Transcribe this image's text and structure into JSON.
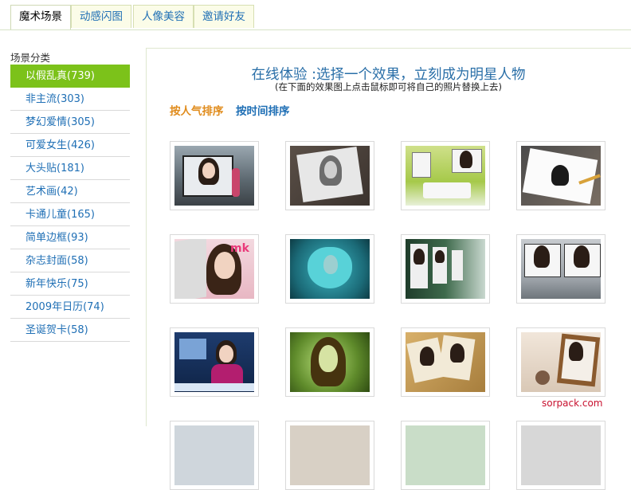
{
  "tabs": [
    {
      "label": "魔术场景",
      "active": true
    },
    {
      "label": "动感闪图",
      "active": false
    },
    {
      "label": "人像美容",
      "active": false
    },
    {
      "label": "邀请好友",
      "active": false
    }
  ],
  "sidebar": {
    "title": "场景分类",
    "items": [
      {
        "label": "以假乱真(739)",
        "active": true
      },
      {
        "label": "非主流(303)"
      },
      {
        "label": "梦幻爱情(305)"
      },
      {
        "label": "可爱女生(426)"
      },
      {
        "label": "大头贴(181)"
      },
      {
        "label": "艺术画(42)"
      },
      {
        "label": "卡通儿童(165)"
      },
      {
        "label": "简单边框(93)"
      },
      {
        "label": "杂志封面(58)"
      },
      {
        "label": "新年快乐(75)"
      },
      {
        "label": "2009年日历(74)"
      },
      {
        "label": "圣诞贺卡(58)"
      }
    ]
  },
  "main": {
    "headline": "在线体验 :选择一个效果，立刻成为明星人物",
    "subline": "(在下面的效果图上点击鼠标即可将自己的照片替换上去)",
    "sort_popular": "按人气排序",
    "sort_time": "按时间排序"
  },
  "watermark": "sorpack.com",
  "colors": {
    "accent_green": "#7cc21a",
    "link_blue": "#1f6fb5",
    "sort_orange": "#e08b1b",
    "headline_blue": "#2a6fa8"
  }
}
